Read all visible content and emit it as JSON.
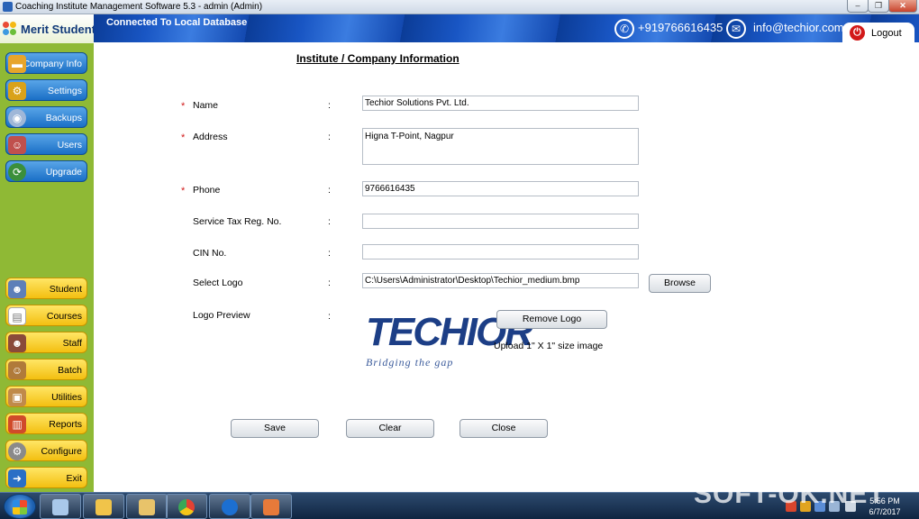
{
  "window": {
    "title": "Coaching Institute Management Software 5.3  -  admin (Admin)",
    "minimize_glyph": "–",
    "maximize_glyph": "❐",
    "close_glyph": "✕"
  },
  "header": {
    "connection_status": "Connected To  Local Database",
    "phone": "+919766616435",
    "email": "info@techior.com",
    "logout_label": "Logout"
  },
  "sidebar": {
    "brand": "Merit Students",
    "top_items": [
      {
        "label": "Company Info",
        "icon": "folder-icon"
      },
      {
        "label": "Settings",
        "icon": "gears-icon"
      },
      {
        "label": "Backups",
        "icon": "disc-icon"
      },
      {
        "label": "Users",
        "icon": "users-icon"
      },
      {
        "label": "Upgrade",
        "icon": "upgrade-icon"
      }
    ],
    "bottom_items": [
      {
        "label": "Student",
        "icon": "student-icon"
      },
      {
        "label": "Courses",
        "icon": "courses-icon"
      },
      {
        "label": "Staff",
        "icon": "staff-icon"
      },
      {
        "label": "Batch",
        "icon": "batch-icon"
      },
      {
        "label": "Utilities",
        "icon": "utilities-icon"
      },
      {
        "label": "Reports",
        "icon": "reports-icon"
      },
      {
        "label": "Configure",
        "icon": "configure-icon"
      },
      {
        "label": "Exit",
        "icon": "exit-icon"
      }
    ]
  },
  "form": {
    "title": "Institute / Company Information",
    "colon": ":",
    "required_marker": "*",
    "fields": {
      "name": {
        "label": "Name",
        "value": "Techior Solutions Pvt. Ltd."
      },
      "address": {
        "label": "Address",
        "value": "Higna T-Point, Nagpur"
      },
      "phone": {
        "label": "Phone",
        "value": "9766616435"
      },
      "service_tax": {
        "label": "Service Tax Reg. No.",
        "value": ""
      },
      "cin": {
        "label": "CIN No.",
        "value": ""
      },
      "select_logo": {
        "label": "Select Logo",
        "value": "C:\\Users\\Administrator\\Desktop\\Techior_medium.bmp"
      },
      "logo_preview": {
        "label": "Logo Preview"
      }
    },
    "browse_label": "Browse",
    "remove_logo_label": "Remove Logo",
    "logo_hint": "Upload 1\" X 1\" size image",
    "logo_image": {
      "word": "TECHIOR",
      "tagline": "Bridging the gap"
    },
    "save_label": "Save",
    "clear_label": "Clear",
    "close_label": "Close"
  },
  "taskbar": {
    "time": "5:56 PM",
    "date": "6/7/2017",
    "watermark": "SOFT-OK.NET"
  },
  "colors": {
    "sidebar_green": "#8fb935",
    "nav_blue": "#1a6fc6",
    "nav_yellow": "#f3bf10",
    "header_blue": "#1956c4",
    "required_red": "#d11a1a",
    "logo_blue": "#1c3e86"
  }
}
